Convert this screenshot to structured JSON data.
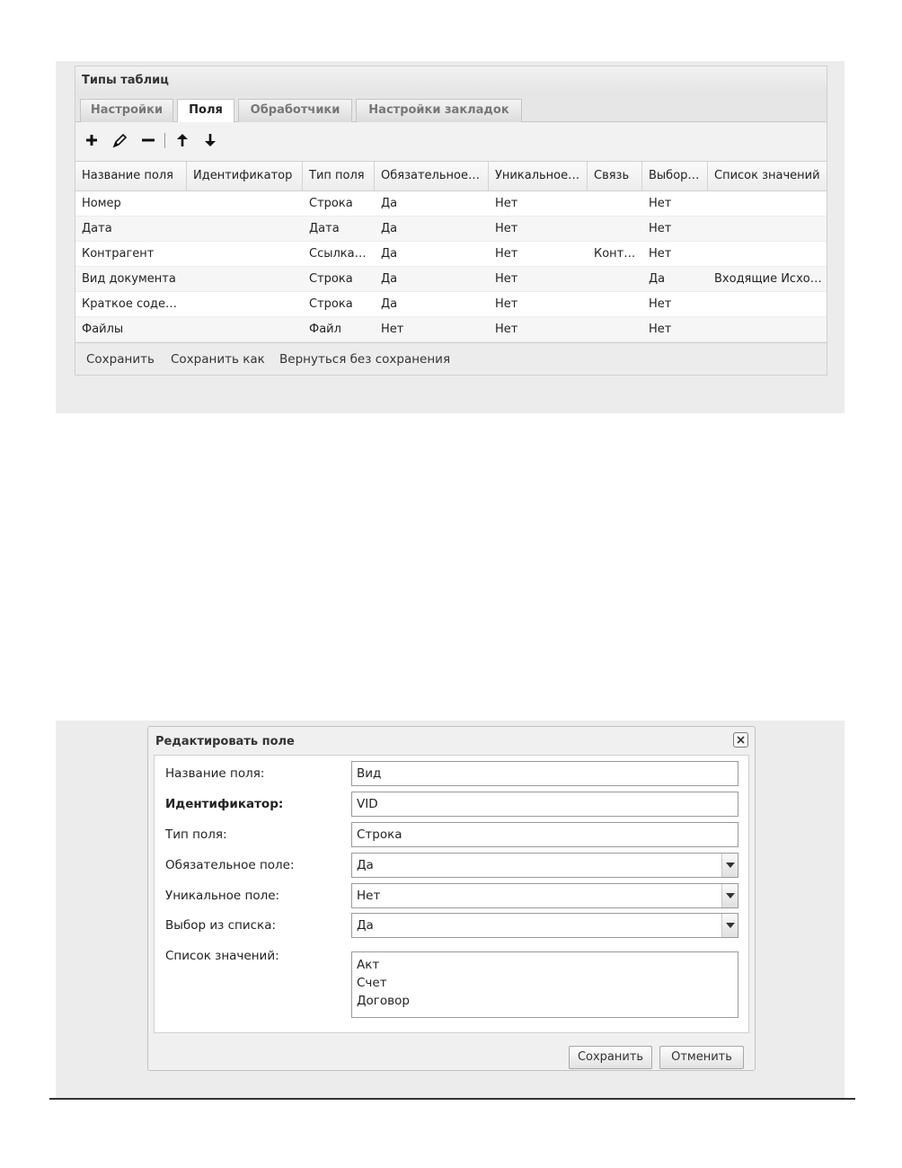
{
  "types_window": {
    "title": "Типы таблиц",
    "tabs": [
      {
        "label": "Настройки",
        "active": false
      },
      {
        "label": "Поля",
        "active": true
      },
      {
        "label": "Обработчики",
        "active": false
      },
      {
        "label": "Настройки закладок",
        "active": false
      }
    ],
    "toolbar": [
      "plus-icon",
      "pencil-icon",
      "minus-icon",
      "arrow-up-icon",
      "arrow-down-icon"
    ],
    "columns": [
      "Название поля",
      "Идентификатор",
      "Тип поля",
      "Обязательное…",
      "Уникальное…",
      "Связь",
      "Выбор…",
      "Список значений"
    ],
    "rows": [
      [
        "Номер",
        "",
        "Строка",
        "Да",
        "Нет",
        "",
        "Нет",
        ""
      ],
      [
        "Дата",
        "",
        "Дата",
        "Да",
        "Нет",
        "",
        "Нет",
        ""
      ],
      [
        "Контрагент",
        "",
        "Ссылка…",
        "Да",
        "Нет",
        "Конт…",
        "Нет",
        ""
      ],
      [
        "Вид документа",
        "",
        "Строка",
        "Да",
        "Нет",
        "",
        "Да",
        "Входящие Исхо…"
      ],
      [
        "Краткое соде…",
        "",
        "Строка",
        "Да",
        "Нет",
        "",
        "Нет",
        ""
      ],
      [
        "Файлы",
        "",
        "Файл",
        "Нет",
        "Нет",
        "",
        "Нет",
        ""
      ]
    ],
    "footer": {
      "save": "Сохранить",
      "save_as": "Сохранить как",
      "back": "Вернуться без сохранения"
    }
  },
  "edit_dialog": {
    "title": "Редактировать поле",
    "fields": {
      "name": {
        "label": "Название поля:",
        "value": "Вид"
      },
      "identifier": {
        "label": "Идентификатор:",
        "value": "VID"
      },
      "type": {
        "label": "Тип поля:",
        "value": "Строка"
      },
      "required": {
        "label": "Обязательное поле:",
        "value": "Да"
      },
      "unique": {
        "label": "Уникальное поле:",
        "value": "Нет"
      },
      "choice": {
        "label": "Выбор из списка:",
        "value": "Да"
      },
      "values": {
        "label": "Список значений:",
        "items": [
          "Акт",
          "Счет",
          "Договор"
        ]
      }
    },
    "buttons": {
      "save": "Сохранить",
      "cancel": "Отменить"
    }
  }
}
